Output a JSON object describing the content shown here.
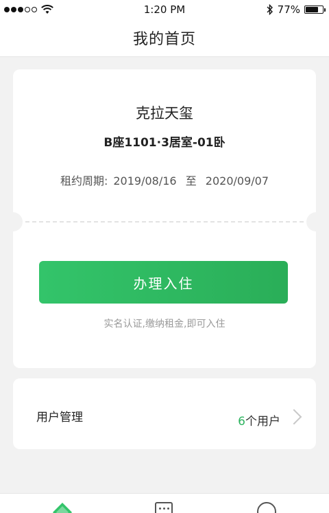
{
  "status_bar": {
    "time": "1:20 PM",
    "battery": "77%",
    "battery_level": 0.77
  },
  "nav": {
    "title": "我的首页"
  },
  "lease_card": {
    "property_name": "克拉天玺",
    "room_info": "B座1101·3居室-01卧",
    "period_label": "租约周期:",
    "start_date": "2019/08/16",
    "to_label": "至",
    "end_date": "2020/09/07",
    "checkin_button": "办理入住",
    "checkin_hint": "实名认证,缴纳租金,即可入住"
  },
  "users_card": {
    "title": "用户管理",
    "count": "6",
    "count_suffix": "个用户"
  },
  "colors": {
    "accent": "#2db35f",
    "background": "#f2f2f2"
  },
  "tab_bar": {
    "icons": [
      "home-icon",
      "message-icon",
      "profile-icon"
    ]
  }
}
